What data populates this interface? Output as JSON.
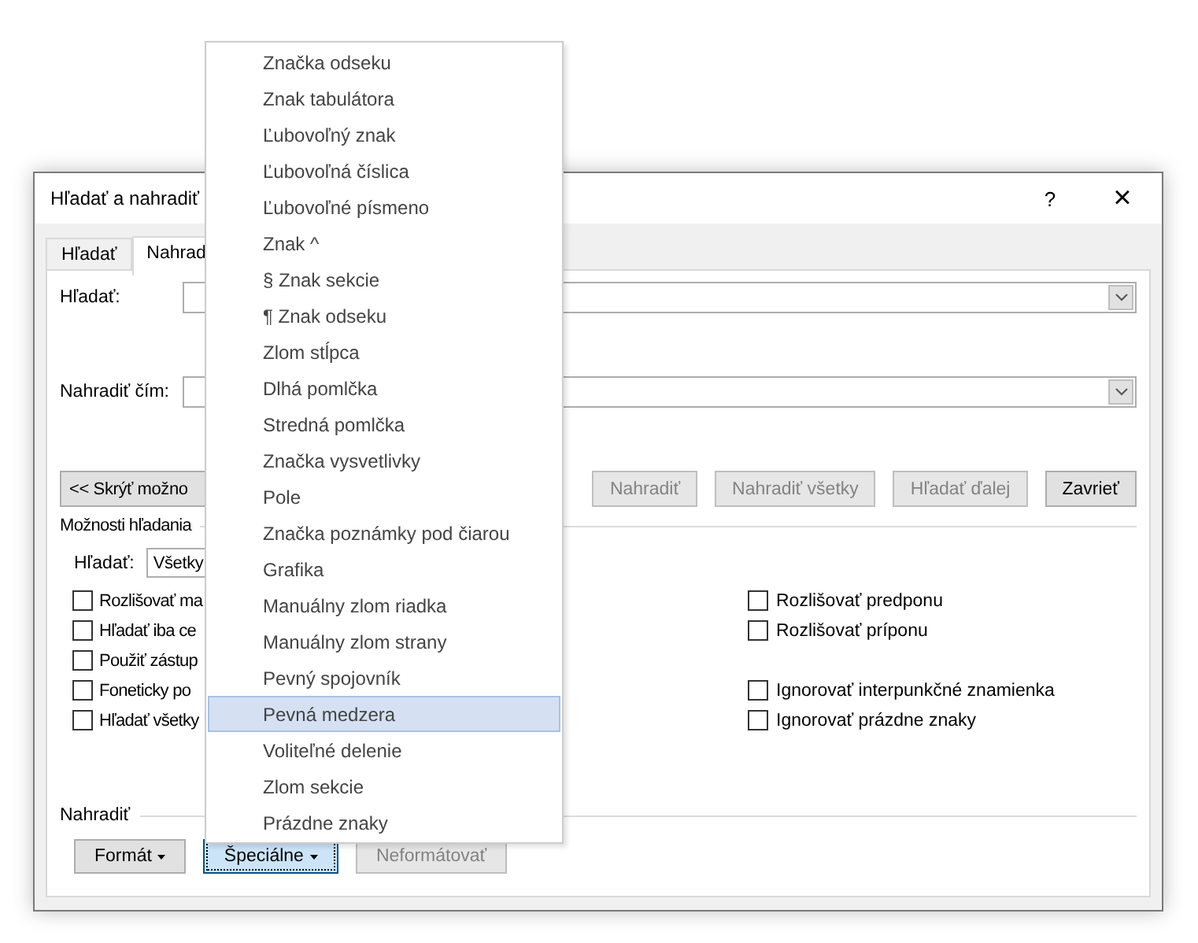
{
  "window": {
    "title": "Hľadať a nahradiť",
    "help": "?",
    "close": "×"
  },
  "tabs": [
    {
      "label": "Hľadať",
      "selected": false
    },
    {
      "label": "Nahrad",
      "selected": true
    }
  ],
  "find": {
    "label": "Hľadať:"
  },
  "replace": {
    "label": "Nahradiť čím:"
  },
  "options_toggle": "<< Skrýť možno",
  "action_buttons": [
    {
      "label": "Nahradiť",
      "disabled": true
    },
    {
      "label": "Nahradiť všetky",
      "disabled": true
    },
    {
      "label": "Hľadať ďalej",
      "disabled": true
    },
    {
      "label": "Zavrieť",
      "disabled": false
    }
  ],
  "search_options": {
    "title": "Možnosti hľadania",
    "direction_label": "Hľadať:",
    "direction_value": "Všetky",
    "left": [
      {
        "label": "Rozlišovať ma",
        "checked": false
      },
      {
        "label": "Hľadať iba ce",
        "checked": false
      },
      {
        "label": "Použiť zástup",
        "checked": false
      },
      {
        "label": "Foneticky po",
        "checked": false
      },
      {
        "label": "Hľadať všetky",
        "checked": false
      }
    ],
    "right_groups": [
      [
        {
          "label": "Rozlišovať predponu",
          "checked": false
        },
        {
          "label": "Rozlišovať príponu",
          "checked": false
        }
      ],
      [
        {
          "label": "Ignorovať interpunkčné znamienka",
          "checked": false
        },
        {
          "label": "Ignorovať prázdne znaky",
          "checked": false
        }
      ]
    ]
  },
  "replace_section": {
    "title": "Nahradiť",
    "buttons": [
      {
        "label": "Formát",
        "kind": "dropdown",
        "disabled": false,
        "pressed": false
      },
      {
        "label": "Špeciálne",
        "kind": "dropdown",
        "disabled": false,
        "pressed": true
      },
      {
        "label": "Neformátovať",
        "kind": "plain",
        "disabled": true,
        "pressed": false
      }
    ]
  },
  "menu": {
    "items": [
      {
        "label": "Značka odseku",
        "selected": false
      },
      {
        "label": "Znak tabulátora",
        "selected": false
      },
      {
        "label": "Ľubovoľný znak",
        "selected": false
      },
      {
        "label": "Ľubovoľná číslica",
        "selected": false
      },
      {
        "label": "Ľubovoľné písmeno",
        "selected": false
      },
      {
        "label": "Znak ^",
        "selected": false
      },
      {
        "label": "§ Znak sekcie",
        "selected": false
      },
      {
        "label": "¶ Znak odseku",
        "selected": false
      },
      {
        "label": "Zlom stĺpca",
        "selected": false
      },
      {
        "label": "Dlhá pomlčka",
        "selected": false
      },
      {
        "label": "Stredná pomlčka",
        "selected": false
      },
      {
        "label": "Značka vysvetlivky",
        "selected": false
      },
      {
        "label": "Pole",
        "selected": false
      },
      {
        "label": "Značka poznámky pod čiarou",
        "selected": false
      },
      {
        "label": "Grafika",
        "selected": false
      },
      {
        "label": "Manuálny zlom riadka",
        "selected": false
      },
      {
        "label": "Manuálny zlom strany",
        "selected": false
      },
      {
        "label": "Pevný spojovník",
        "selected": false
      },
      {
        "label": "Pevná medzera",
        "selected": true
      },
      {
        "label": "Voliteľné delenie",
        "selected": false
      },
      {
        "label": "Zlom sekcie",
        "selected": false
      },
      {
        "label": "Prázdne znaky",
        "selected": false
      }
    ]
  }
}
